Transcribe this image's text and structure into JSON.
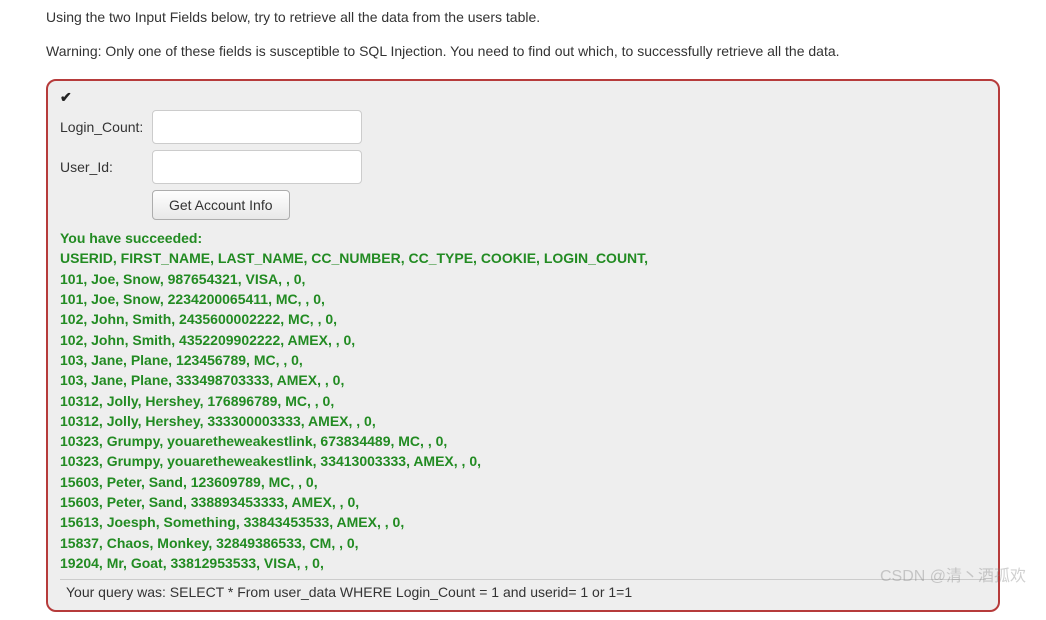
{
  "intro": "Using the two Input Fields below, try to retrieve all the data from the users table.",
  "warning": "Warning: Only one of these fields is susceptible to SQL Injection. You need to find out which, to successfully retrieve all the data.",
  "form": {
    "login_count_label": "Login_Count:",
    "login_count_value": "",
    "user_id_label": "User_Id:",
    "user_id_value": "",
    "button_label": "Get Account Info"
  },
  "results": {
    "success_text": "You have succeeded:",
    "columns": "USERID, FIRST_NAME, LAST_NAME, CC_NUMBER, CC_TYPE, COOKIE, LOGIN_COUNT,",
    "rows": [
      "101, Joe, Snow, 987654321, VISA, , 0,",
      "101, Joe, Snow, 2234200065411, MC, , 0,",
      "102, John, Smith, 2435600002222, MC, , 0,",
      "102, John, Smith, 4352209902222, AMEX, , 0,",
      "103, Jane, Plane, 123456789, MC, , 0,",
      "103, Jane, Plane, 333498703333, AMEX, , 0,",
      "10312, Jolly, Hershey, 176896789, MC, , 0,",
      "10312, Jolly, Hershey, 333300003333, AMEX, , 0,",
      "10323, Grumpy, youaretheweakestlink, 673834489, MC, , 0,",
      "10323, Grumpy, youaretheweakestlink, 33413003333, AMEX, , 0,",
      "15603, Peter, Sand, 123609789, MC, , 0,",
      "15603, Peter, Sand, 338893453333, AMEX, , 0,",
      "15613, Joesph, Something, 33843453533, AMEX, , 0,",
      "15837, Chaos, Monkey, 32849386533, CM, , 0,",
      "19204, Mr, Goat, 33812953533, VISA, , 0,"
    ]
  },
  "query": "Your query was: SELECT * From user_data WHERE Login_Count = 1 and userid= 1 or 1=1",
  "watermark": "CSDN @清丶酒孤欢"
}
